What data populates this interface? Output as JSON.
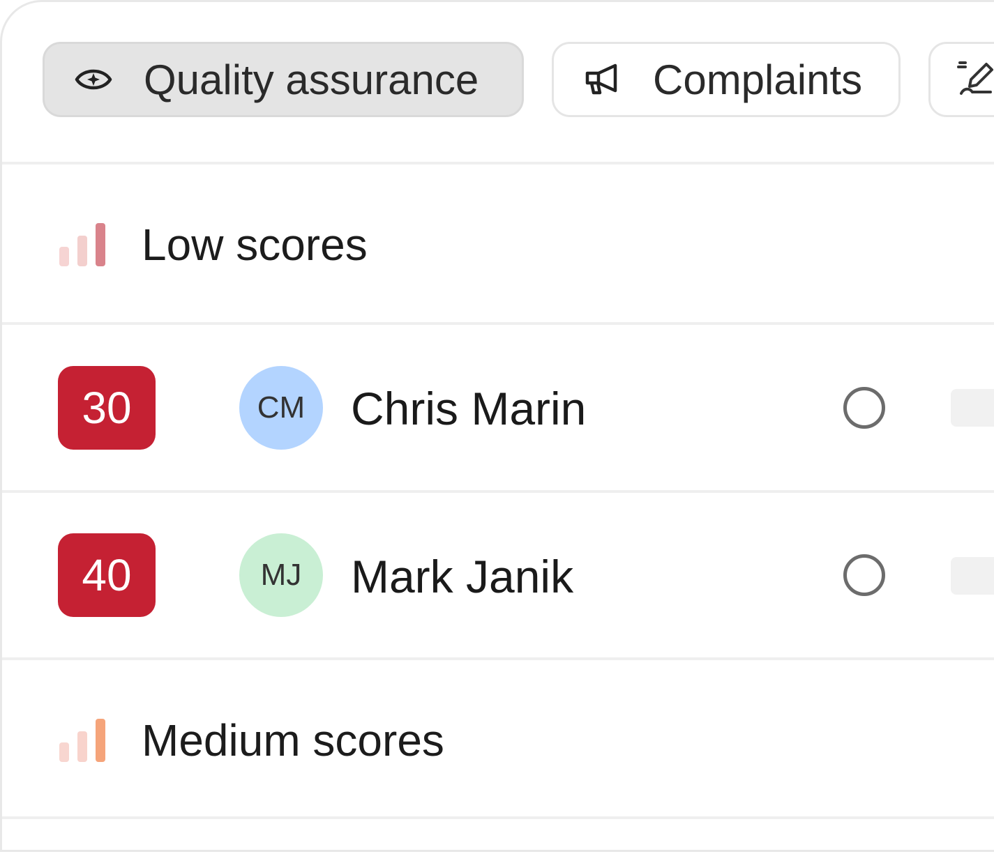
{
  "tabs": {
    "quality_assurance": {
      "label": "Quality assurance",
      "icon": "eye-sparkle-icon",
      "active": true
    },
    "complaints": {
      "label": "Complaints",
      "icon": "megaphone-icon",
      "active": false
    },
    "third": {
      "label": "",
      "icon": "pen-signature-icon",
      "active": false
    }
  },
  "groups": {
    "low": {
      "title": "Low scores",
      "icon": "signal-bars-icon",
      "accent": "#d9838b",
      "faded": "#f6d4d3"
    },
    "medium": {
      "title": "Medium scores",
      "icon": "signal-bars-icon",
      "accent": "#f5a47a",
      "faded": "#f8d6d0"
    }
  },
  "rows": [
    {
      "score": "30",
      "initials": "CM",
      "name": "Chris Marin",
      "avatar_color": "#b3d4ff",
      "score_color": "#c52133"
    },
    {
      "score": "40",
      "initials": "MJ",
      "name": "Mark Janik",
      "avatar_color": "#c9efd4",
      "score_color": "#c52133"
    }
  ]
}
